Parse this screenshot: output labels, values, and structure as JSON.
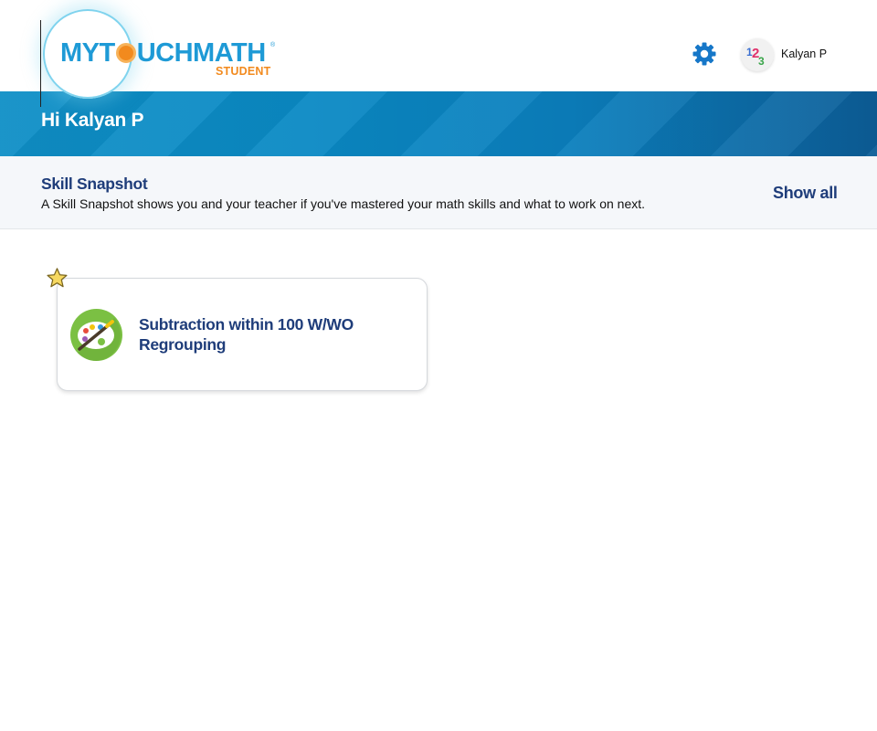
{
  "header": {
    "logo": {
      "word": [
        "MYT",
        "UCHMATH"
      ],
      "sub": "STUDENT",
      "reg": "®"
    },
    "settings_icon": "gear-icon",
    "user": {
      "avatar_icon": "123-avatar-icon",
      "name": "Kalyan P"
    }
  },
  "banner": {
    "greeting": "Hi Kalyan P"
  },
  "skill_snapshot": {
    "title": "Skill Snapshot",
    "description": "A Skill Snapshot shows you and your teacher if you've mastered your math skills and what to work on next.",
    "show_all": "Show all"
  },
  "skills": [
    {
      "title": "Subtraction within 100 W/WO Regrouping",
      "icon": "palette-icon",
      "badge_icon": "star-icon"
    }
  ],
  "colors": {
    "brand_blue": "#1e9ad6",
    "brand_orange": "#f28a1e",
    "navy": "#1f3d7a",
    "banner": "#0a89c4",
    "icon_green": "#7bc043"
  }
}
